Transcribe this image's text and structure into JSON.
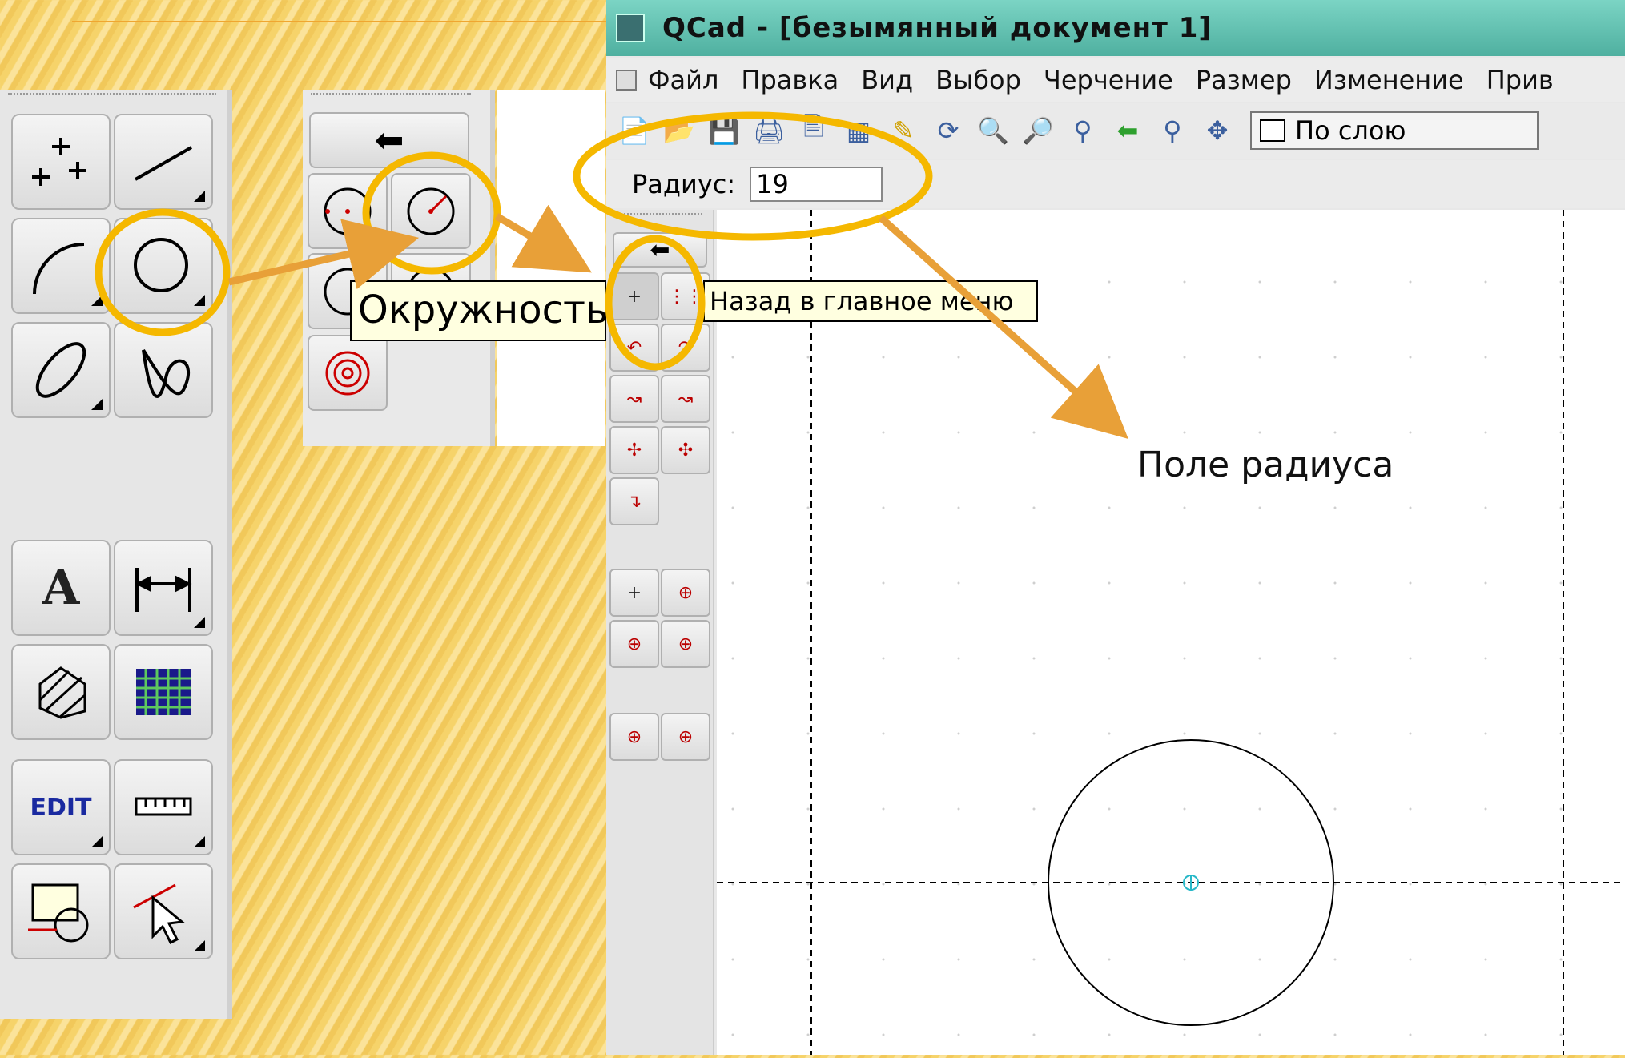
{
  "window": {
    "title": "QCad - [безымянный документ 1]",
    "menu": [
      "Файл",
      "Правка",
      "Вид",
      "Выбор",
      "Черчение",
      "Размер",
      "Изменение",
      "Прив"
    ],
    "layer_select_value": "По слою"
  },
  "options": {
    "radius_label": "Радиус:",
    "radius_value": "19"
  },
  "tooltips": {
    "circle": "Окружность",
    "back_to_main": "Назад в главное меню"
  },
  "left_toolbar": {
    "text_button_label": "A",
    "edit_button_label": "EDIT"
  },
  "annotation": {
    "radius_field": "Поле радиуса"
  },
  "colors": {
    "highlight": "#f5b800",
    "arrow": "#e8a038",
    "title_bar": "#5fbfae"
  }
}
